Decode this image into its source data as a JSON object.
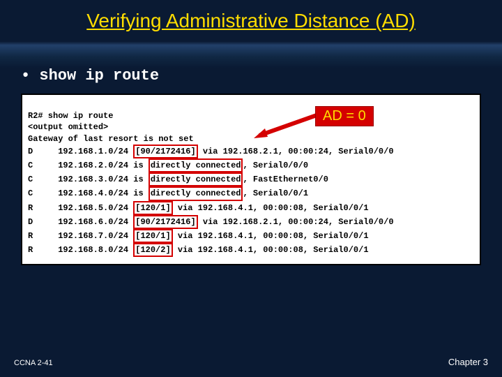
{
  "title": "Verifying Administrative Distance (AD)",
  "bullet": "show ip route",
  "callout": "AD = 0",
  "terminal": {
    "prompt": "R2# show ip route",
    "omitted": "<output omitted>",
    "gateway": "Gateway of last resort is not set",
    "rows": [
      {
        "code": "D",
        "net": "192.168.1.0/24",
        "metric": "[90/2172416]",
        "rest": " via 192.168.2.1, 00:00:24, Serial0/0/0"
      },
      {
        "code": "C",
        "net": "192.168.2.0/24",
        "pre": "is ",
        "metric": "directly connected",
        "rest": ", Serial0/0/0"
      },
      {
        "code": "C",
        "net": "192.168.3.0/24",
        "pre": "is ",
        "metric": "directly connected",
        "rest": ", FastEthernet0/0"
      },
      {
        "code": "C",
        "net": "192.168.4.0/24",
        "pre": "is ",
        "metric": "directly connected",
        "rest": ", Serial0/0/1"
      },
      {
        "code": "R",
        "net": "192.168.5.0/24",
        "metric": "[120/1]",
        "rest": " via 192.168.4.1, 00:00:08, Serial0/0/1"
      },
      {
        "code": "D",
        "net": "192.168.6.0/24",
        "metric": "[90/2172416]",
        "rest": " via 192.168.2.1, 00:00:24, Serial0/0/0"
      },
      {
        "code": "R",
        "net": "192.168.7.0/24",
        "metric": "[120/1]",
        "rest": " via 192.168.4.1, 00:00:08, Serial0/0/1"
      },
      {
        "code": "R",
        "net": "192.168.8.0/24",
        "metric": "[120/2]",
        "rest": " via 192.168.4.1, 00:00:08, Serial0/0/1"
      }
    ]
  },
  "footer": {
    "left": "CCNA 2-41",
    "right": "Chapter 3"
  }
}
